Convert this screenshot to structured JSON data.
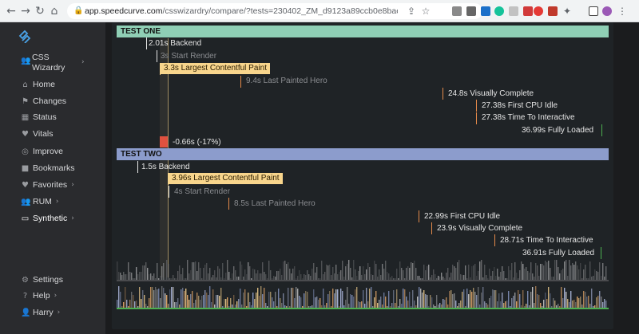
{
  "browser": {
    "url_domain": "app.speedcurve.com",
    "url_path": "/csswizardry/compare/?tests=230402_ZM_d9123a89ccb0e8baec576dd30f2dff19,2304...",
    "extension_icons": [
      "camera-icon",
      "cast-icon",
      "grammarly-icon",
      "extension-icon",
      "pin-icon",
      "abp-icon",
      "red-extension-icon",
      "puzzle-icon",
      "sidebar-icon",
      "profile-avatar",
      "menu-icon"
    ]
  },
  "sidebar": {
    "site_label": "CSS Wizardry",
    "items": [
      {
        "label": "Home",
        "icon": "home-icon",
        "chevron": ""
      },
      {
        "label": "Changes",
        "icon": "changes-icon",
        "chevron": ""
      },
      {
        "label": "Status",
        "icon": "status-icon",
        "chevron": ""
      },
      {
        "label": "Vitals",
        "icon": "vitals-icon",
        "chevron": ""
      },
      {
        "label": "Improve",
        "icon": "improve-icon",
        "chevron": ""
      },
      {
        "label": "Bookmarks",
        "icon": "bookmark-icon",
        "chevron": ""
      },
      {
        "label": "Favorites",
        "icon": "heart-icon",
        "chevron": "›"
      },
      {
        "label": "RUM",
        "icon": "users-icon",
        "chevron": "›"
      },
      {
        "label": "Synthetic",
        "icon": "monitor-icon",
        "chevron": "›"
      }
    ],
    "bottom_items": [
      {
        "label": "Settings",
        "icon": "gear-icon"
      },
      {
        "label": "Help",
        "icon": "help-icon",
        "chevron": "›"
      },
      {
        "label": "Harry",
        "icon": "user-icon",
        "chevron": "›"
      }
    ]
  },
  "comparison": {
    "test_one": {
      "title": "TEST ONE",
      "metrics": [
        {
          "label": "2.01s Backend",
          "style": "normal"
        },
        {
          "label": "3s Start Render",
          "style": "dim"
        },
        {
          "label": "3.3s Largest Contentful Paint",
          "style": "lcp"
        },
        {
          "label": "9.4s Last Painted Hero",
          "style": "dim"
        },
        {
          "label": "24.8s Visually Complete",
          "style": "normal"
        },
        {
          "label": "27.38s First CPU Idle",
          "style": "normal"
        },
        {
          "label": "27.38s Time To Interactive",
          "style": "normal"
        },
        {
          "label": "36.99s Fully Loaded",
          "style": "normal"
        }
      ]
    },
    "delta_label": "-0.66s (-17%)",
    "test_two": {
      "title": "TEST TWO",
      "metrics": [
        {
          "label": "1.5s Backend",
          "style": "normal"
        },
        {
          "label": "3.96s Largest Contentful Paint",
          "style": "lcp"
        },
        {
          "label": "4s Start Render",
          "style": "dim"
        },
        {
          "label": "8.5s Last Painted Hero",
          "style": "dim"
        },
        {
          "label": "22.99s First CPU Idle",
          "style": "normal"
        },
        {
          "label": "23.9s Visually Complete",
          "style": "normal"
        },
        {
          "label": "28.71s Time To Interactive",
          "style": "normal"
        },
        {
          "label": "36.91s Fully Loaded",
          "style": "normal"
        }
      ]
    }
  },
  "colors": {
    "test_one_header": "#8fcfb5",
    "test_two_header": "#8c9ccc",
    "lcp_highlight": "#f8d58c",
    "delta_red": "#e0513f",
    "marker_white": "#e6e6e6",
    "marker_orange": "#e58a4a",
    "marker_green": "#4caf50"
  }
}
